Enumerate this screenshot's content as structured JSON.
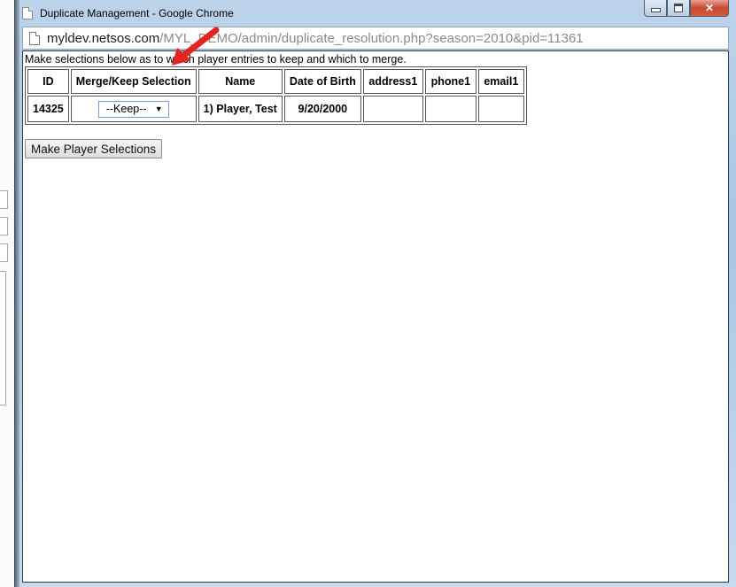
{
  "window": {
    "title": "Duplicate Management - Google Chrome",
    "controls": {
      "minimize": "minimize",
      "maximize": "maximize",
      "close": "close"
    }
  },
  "address": {
    "host": "myldev.netsos.com",
    "path": "/MYL_DEMO/admin/duplicate_resolution.php?season=2010&pid=11361"
  },
  "page": {
    "intro": "Make selections below as to which player entries to keep and which to merge.",
    "table": {
      "headers": [
        "ID",
        "Merge/Keep Selection",
        "Name",
        "Date of Birth",
        "address1",
        "phone1",
        "email1"
      ],
      "rows": [
        {
          "id": "14325",
          "selection": "--Keep--",
          "name": "1) Player, Test",
          "dob": "9/20/2000",
          "address1": "",
          "phone1": "",
          "email1": ""
        }
      ]
    },
    "submit_label": "Make Player Selections"
  },
  "annotation": {
    "type": "red-arrow",
    "color": "#e52421"
  }
}
